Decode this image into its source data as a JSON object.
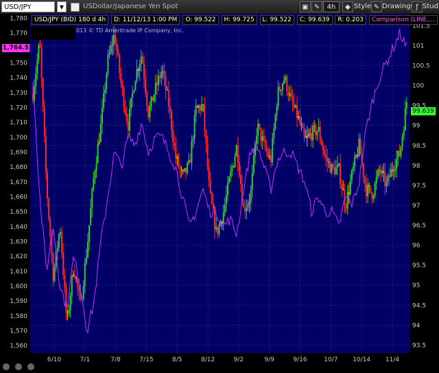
{
  "toolbar": {
    "symbol": "USD/JPY",
    "description": "USDollar/Japanese Yen Spot",
    "period": "4h",
    "style_label": "Style",
    "drawings_label": "Drawings",
    "studies_label": "Studie",
    "icons": [
      "link-icon",
      "pin-icon",
      "gear-icon",
      "style-icon",
      "drawings-icon",
      "studies-icon"
    ]
  },
  "header": {
    "series": "USD/JPY (BID) 180 d 4h",
    "date": "D: 11/12/13 1:00 PM",
    "open": "O: 99.522",
    "high": "H: 99.725",
    "low": "L: 99.522",
    "close": "C: 99.639",
    "range": "R: 0.203",
    "comparison": "Comparison (LINE,..."
  },
  "copyright": "013 © TD Ameritrade IP Company, Inc.",
  "price_tag": "1,764.5",
  "last_tag": "99.639",
  "colors": {
    "plot_bg": "#000067",
    "up": "#33cc33",
    "down": "#ff2a2a",
    "neutral": "#ffb000",
    "comparison": "#c030ff"
  },
  "chart_data": {
    "type": "line",
    "x_ticks": [
      "6/10",
      "7/1",
      "7/8",
      "7/15",
      "8/5",
      "8/12",
      "9/2",
      "9/9",
      "9/16",
      "10/7",
      "10/14",
      "11/4"
    ],
    "left_axis": {
      "ticks": [
        "1,780",
        "1,770",
        "1,760",
        "1,750",
        "1,740",
        "1,730",
        "1,720",
        "1,710",
        "1,700",
        "1,690",
        "1,680",
        "1,670",
        "1,660",
        "1,650",
        "1,640",
        "1,630",
        "1,620",
        "1,610",
        "1,600",
        "1,590",
        "1,580",
        "1,570",
        "1,560"
      ],
      "range": [
        1555,
        1783
      ]
    },
    "right_axis": {
      "ticks": [
        "101.5",
        "101",
        "100.5",
        "100",
        "99.5",
        "99",
        "98.5",
        "98",
        "97.5",
        "97",
        "96.5",
        "96",
        "95.5",
        "95",
        "94.5",
        "94",
        "93.5"
      ],
      "range": [
        93.3,
        101.8
      ]
    },
    "series": [
      {
        "name": "USD/JPY",
        "style": "candles",
        "values": [
          99.8,
          101.1,
          97.5,
          95.2,
          96.5,
          94.0,
          95.5,
          94.5,
          96.0,
          97.8,
          99.0,
          100.6,
          101.3,
          100.0,
          99.0,
          100.2,
          100.8,
          99.3,
          99.9,
          100.4,
          99.5,
          98.2,
          97.7,
          98.0,
          99.4,
          99.5,
          97.3,
          96.3,
          96.8,
          97.7,
          98.5,
          96.9,
          97.2,
          99.0,
          98.5,
          98.1,
          99.8,
          100.2,
          99.6,
          99.2,
          98.6,
          98.8,
          98.9,
          98.2,
          97.9,
          97.9,
          97.0,
          97.8,
          98.5,
          97.4,
          97.3,
          97.9,
          97.5,
          98.0,
          98.3,
          99.6
        ]
      },
      {
        "name": "Comparison",
        "style": "line",
        "values": [
          1740,
          1660,
          1610,
          1640,
          1600,
          1585,
          1620,
          1600,
          1570,
          1590,
          1630,
          1660,
          1690,
          1680,
          1700,
          1695,
          1710,
          1690,
          1700,
          1700,
          1690,
          1680,
          1660,
          1640,
          1650,
          1665,
          1650,
          1650,
          1640,
          1645,
          1635,
          1665,
          1690,
          1695,
          1680,
          1665,
          1685,
          1690,
          1690,
          1680,
          1670,
          1650,
          1660,
          1650,
          1650,
          1640,
          1660,
          1655,
          1670,
          1705,
          1725,
          1740,
          1750,
          1760,
          1770,
          1760
        ]
      }
    ]
  }
}
